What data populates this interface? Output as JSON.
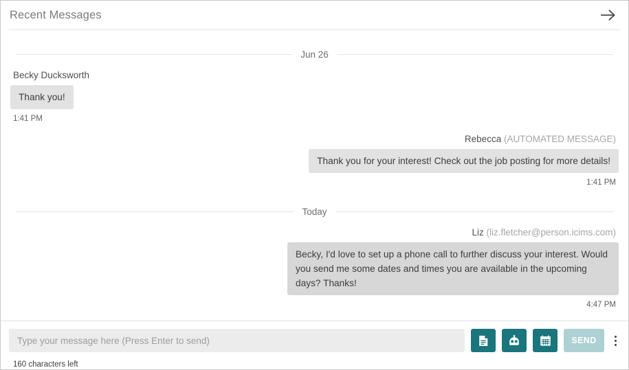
{
  "header": {
    "title": "Recent Messages",
    "forward_icon": "arrow-right-icon"
  },
  "conversation": [
    {
      "type": "day_divider",
      "label": "Jun 26"
    },
    {
      "type": "message",
      "direction": "incoming",
      "sender": "Becky Ducksworth",
      "sender_meta": "",
      "text": "Thank you!",
      "time": "1:41 PM"
    },
    {
      "type": "message",
      "direction": "outgoing",
      "sender": "Rebecca",
      "sender_meta": "(AUTOMATED MESSAGE)",
      "text": "Thank you for your interest! Check out the job posting for more details!",
      "time": "1:41 PM"
    },
    {
      "type": "day_divider",
      "label": "Today"
    },
    {
      "type": "message",
      "direction": "outgoing",
      "sender": "Liz",
      "sender_meta": "(liz.fletcher@person.icims.com)",
      "text": "Becky, I'd love to set up a phone call to further discuss your interest. Would you send me some dates and times you are available in the upcoming days? Thanks!",
      "time": "4:47 PM"
    }
  ],
  "composer": {
    "placeholder": "Type your message here (Press Enter to send)",
    "value": "",
    "buttons": [
      {
        "name": "template-icon",
        "title": "Template"
      },
      {
        "name": "robot-icon",
        "title": "Automation"
      },
      {
        "name": "calendar-icon",
        "title": "Schedule"
      }
    ],
    "send_label": "SEND",
    "send_enabled": false,
    "overflow_icon": "kebab-menu-icon",
    "character_counter": "160 characters left"
  },
  "colors": {
    "accent_teal": "#1a757c",
    "send_disabled": "#add0d2",
    "bubble_gray": "#e2e2e2",
    "bubble_gray_dark": "#d7d7d7",
    "title_gray": "#7b7b7b"
  }
}
